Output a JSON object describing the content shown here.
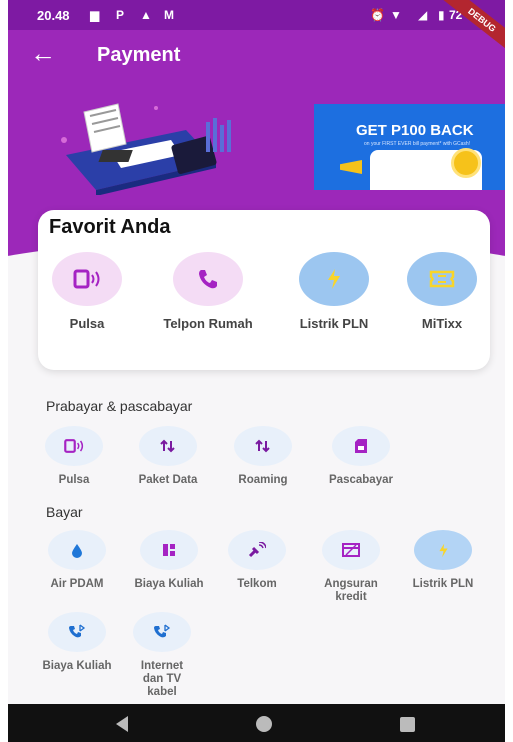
{
  "status_bar": {
    "time": "20.48",
    "battery": "72",
    "debug_banner": "DEBUG"
  },
  "app_bar": {
    "title": "Payment"
  },
  "promo": {
    "title": "GET P100 BACK",
    "subtitle": "on your FIRST EVER bill payment* with GCash!"
  },
  "favorites": {
    "title": "Favorit Anda",
    "items": [
      {
        "label": "Pulsa",
        "icon": "phone-signal-icon"
      },
      {
        "label": "Telpon Rumah",
        "icon": "telephone-icon"
      },
      {
        "label": "Listrik PLN",
        "icon": "lightning-icon"
      },
      {
        "label": "MiTixx",
        "icon": "ticket-icon"
      }
    ]
  },
  "prabayar": {
    "title": "Prabayar & pascabayar",
    "items": [
      {
        "label": "Pulsa",
        "icon": "phone-signal-icon"
      },
      {
        "label": "Paket Data",
        "icon": "data-arrows-icon"
      },
      {
        "label": "Roaming",
        "icon": "data-arrows-icon"
      },
      {
        "label": "Pascabayar",
        "icon": "sim-card-icon"
      }
    ]
  },
  "bayar": {
    "title": "Bayar",
    "items": [
      {
        "label": "Air PDAM",
        "icon": "water-drop-icon"
      },
      {
        "label": "Biaya Kuliah",
        "icon": "dashboard-icon"
      },
      {
        "label": "Telkom",
        "icon": "satellite-icon"
      },
      {
        "label": "Angsuran kredit",
        "icon": "card-icon"
      },
      {
        "label": "Listrik PLN",
        "icon": "lightning-icon"
      },
      {
        "label": "Biaya Kuliah",
        "icon": "phone-bluetooth-icon"
      },
      {
        "label": "Internet dan TV kabel",
        "icon": "phone-bluetooth-icon"
      }
    ]
  },
  "colors": {
    "primary": "#9c28b9",
    "status_bar": "#7e1aa3",
    "icon_purple": "#a523c3",
    "icon_yellow": "#f8d52a",
    "soft_blue": "#e8f0fa"
  }
}
